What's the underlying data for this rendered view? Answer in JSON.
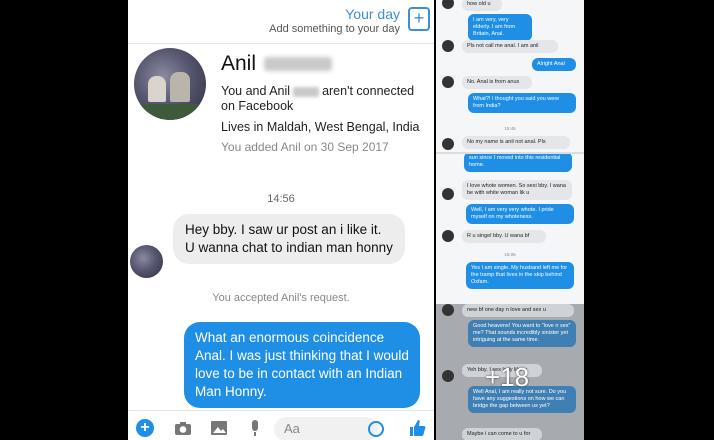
{
  "header": {
    "title": "Your day",
    "subtitle": "Add something to your day",
    "add_icon": "plus-square-icon"
  },
  "profile": {
    "first_name": "Anil",
    "connection_prefix": "You and Anil",
    "connection_suffix": "aren't connected on Facebook",
    "lives": "Lives in Maldah, West Bengal, India",
    "added": "You added Anil on 30 Sep 2017"
  },
  "conversation": {
    "time": "14:56",
    "incoming": "Hey bby. I saw ur post an i like it. U wanna chat to indian man honny",
    "accepted": "You accepted Anil's request.",
    "outgoing": "What an enormous coincidence Anal. I was just thinking that I would love to be in contact with an Indian Man Honny."
  },
  "composer": {
    "placeholder": "Aa",
    "icons": [
      "plus-icon",
      "camera-icon",
      "image-icon",
      "mic-icon",
      "emoji-icon",
      "thumbs-up-icon"
    ]
  },
  "right_panel_1": {
    "messages": [
      {
        "side": "in",
        "text": "how old u"
      },
      {
        "side": "out",
        "text": "I am very, very elderly. I am from Britain, Anal."
      },
      {
        "side": "in",
        "text": "Pls not call me anal. I am anil"
      },
      {
        "side": "out",
        "text": "Alright Anal"
      },
      {
        "side": "in",
        "text": "No. Anal is from anus"
      },
      {
        "side": "out",
        "text": "What?! I thought you said you were from India?"
      },
      {
        "side": "time",
        "text": "15:45"
      },
      {
        "side": "in",
        "text": "No my name is anil not anal. Pls"
      }
    ]
  },
  "right_panel_2": {
    "messages": [
      {
        "side": "out",
        "text": "sun since I moved into this residential home."
      },
      {
        "side": "in",
        "text": "I love whote women. So sexi bby. I wana be with white woman lik u"
      },
      {
        "side": "out",
        "text": "Well, I am very very whote. I pride myself on my whoteness."
      },
      {
        "side": "in",
        "text": "R u singel bby. U wana bf"
      },
      {
        "side": "time",
        "text": "16:06"
      },
      {
        "side": "out",
        "text": "Yes I am single. My husband left me for the tramp that lives in the skip behind Oxfam."
      }
    ]
  },
  "right_panel_3": {
    "more_count": "+18",
    "messages": [
      {
        "side": "in",
        "text": "new bf one day n love and sex u"
      },
      {
        "side": "out",
        "text": "Good heavens! You want to \"love n sex\" me? That sounds incredibly sinister yet intriguing at the same time."
      },
      {
        "side": "in",
        "text": "Yeh bby. I sex lady like u"
      },
      {
        "side": "out",
        "text": "Well Anal, I am really not sure. Do you have any suggestions on how we can bridge the gap between us yet?"
      },
      {
        "side": "in",
        "text": "Maybe i can come to u for"
      }
    ]
  }
}
